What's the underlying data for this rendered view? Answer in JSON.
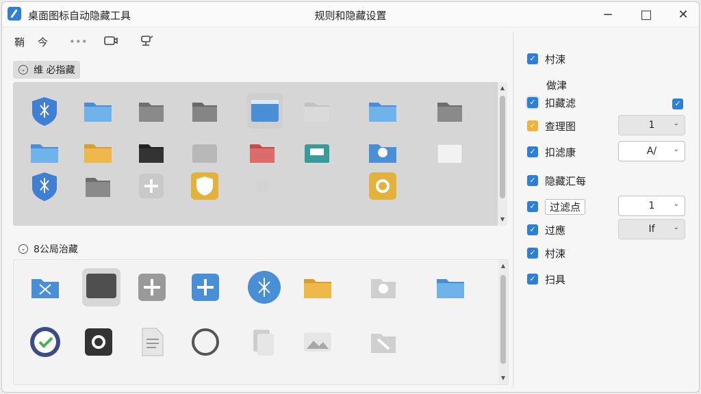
{
  "window": {
    "app_title": "桌面图标自动隐藏工具",
    "center_title": "规则和隐藏设置",
    "controls": [
      "−",
      "□",
      "✕"
    ]
  },
  "toolbar": {
    "items": [
      {
        "label": "鞘",
        "icon": "text-glyph"
      },
      {
        "label": "今",
        "icon": "text-glyph"
      },
      {
        "label": "•••",
        "icon": "more-icon"
      },
      {
        "label": "",
        "icon": "monitor-icon"
      },
      {
        "label": "",
        "icon": "network-icon"
      }
    ]
  },
  "sections": [
    {
      "header": "维 必指藏",
      "expanded": true
    },
    {
      "header": "8公局治藏",
      "expanded": true
    }
  ],
  "grid1_icons": [
    {
      "icon": "shield-git-icon",
      "color": "#3f7fd4"
    },
    {
      "icon": "folder-blue-icon",
      "color": "#5aa2e0"
    },
    {
      "icon": "folder-gray-icon",
      "color": "#808080"
    },
    {
      "icon": "folder-gray-icon",
      "color": "#7a7a7a"
    },
    {
      "icon": "window-app-icon",
      "color": "#5aa2e0"
    },
    {
      "icon": "folder-lightgray-icon",
      "color": "#c8c8c8"
    },
    {
      "icon": "folder-blue-icon",
      "color": "#5aa2e0"
    },
    {
      "icon": "folder-gray-icon",
      "color": "#7a7a7a"
    },
    {
      "icon": "folder-blue-partial-icon",
      "color": "#5aa2e0"
    },
    {
      "icon": "folder-yellow-partial-icon",
      "color": "#e7a93a"
    },
    {
      "icon": "folder-black-partial-icon",
      "color": "#333333"
    },
    {
      "icon": "folder-gray-partial-icon",
      "color": "#b8b8b8"
    },
    {
      "icon": "folder-red-partial-icon",
      "color": "#d96060"
    },
    {
      "icon": "folder-teal-partial-icon",
      "color": "#3a9c9a"
    },
    {
      "icon": "folder-blue-gear-partial-icon",
      "color": "#5aa2e0"
    },
    {
      "icon": "folder-white-partial-icon",
      "color": "#ededed"
    },
    {
      "icon": "shield-git-icon",
      "color": "#3f7fd4"
    },
    {
      "icon": "folder-gray-icon",
      "color": "#808080"
    },
    {
      "icon": "plus-app-icon",
      "color": "#c9c9c9"
    },
    {
      "icon": "shield-yellow-icon",
      "color": "#e3b23c"
    },
    {
      "icon": "gear-faint-icon",
      "color": "#d3d3d3"
    },
    {
      "icon": "gear-yellow-icon",
      "color": "#e3b23c"
    }
  ],
  "grid2_icons": [
    {
      "icon": "git-folder-icon",
      "color": "#5aa2e0"
    },
    {
      "icon": "window-dark-icon",
      "color": "#5a5a5a"
    },
    {
      "icon": "plus-gray-icon",
      "color": "#9a9a9a"
    },
    {
      "icon": "plus-blue-icon",
      "color": "#4a8fd6"
    },
    {
      "icon": "git-circle-icon",
      "color": "#4a8fd6"
    },
    {
      "icon": "folder-orange-icon",
      "color": "#e7a93a"
    },
    {
      "icon": "gear-folder-icon",
      "color": "#cfcfcf"
    },
    {
      "icon": "folder-blue-icon",
      "color": "#5aa2e0"
    },
    {
      "icon": "check-circle-icon",
      "color": "#4caf50"
    },
    {
      "icon": "gear-black-icon",
      "color": "#333333"
    },
    {
      "icon": "document-icon",
      "color": "#d0d0d0"
    },
    {
      "icon": "circle-ring-icon",
      "color": "#555555"
    },
    {
      "icon": "file-copy-icon",
      "color": "#d0d0d0"
    },
    {
      "icon": "image-icon",
      "color": "#d0d0d0"
    },
    {
      "icon": "folder-tool-icon",
      "color": "#cfcfcf"
    }
  ],
  "panel": {
    "rows": [
      {
        "label": "村涑",
        "checked": true
      },
      {
        "label": "做津",
        "checked": false,
        "plain": true
      },
      {
        "label": "扣藏滤",
        "checked": true,
        "ring": true,
        "right_checkbox": true
      },
      {
        "label": "查理图",
        "checked": true,
        "orange": true,
        "select": "1"
      },
      {
        "label": "扣滤康",
        "checked": true,
        "select": "A/"
      },
      {
        "label": "隐藏汇每",
        "checked": true
      },
      {
        "label": "过滤点",
        "checked": true,
        "select": "1"
      },
      {
        "label": "过應",
        "checked": true,
        "select": "If"
      },
      {
        "label": "村涑",
        "checked": true
      },
      {
        "label": "扫具",
        "checked": true
      }
    ]
  },
  "colors": {
    "accent": "#2f7fd6",
    "orange": "#f0b23a"
  }
}
